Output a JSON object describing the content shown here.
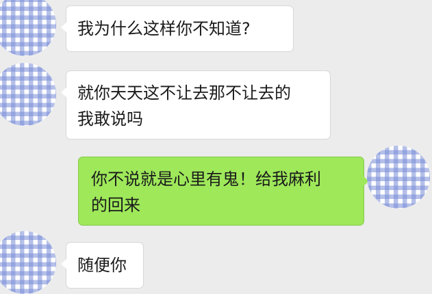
{
  "messages": [
    {
      "side": "incoming",
      "lines": [
        "我为什么这样你不知道?"
      ]
    },
    {
      "side": "incoming",
      "lines": [
        "就你天天这不让去那不让去的",
        "我敢说吗"
      ]
    },
    {
      "side": "outgoing",
      "lines": [
        "你不说就是心里有鬼！给我麻利",
        "的回来"
      ]
    },
    {
      "side": "incoming",
      "lines": [
        "随便你"
      ]
    }
  ],
  "colors": {
    "background": "#ececec",
    "incoming_bubble": "#ffffff",
    "outgoing_bubble": "#9ee85a",
    "avatar_pattern": "blue-white gingham"
  },
  "icons": {
    "contact_avatar": "gingham-avatar-icon",
    "self_avatar": "gingham-avatar-icon"
  }
}
